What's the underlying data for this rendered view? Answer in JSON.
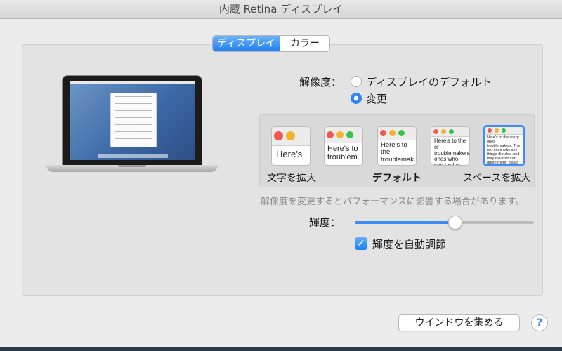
{
  "window": {
    "title": "内蔵 Retina ディスプレイ"
  },
  "tabs": [
    {
      "label": "ディスプレイ",
      "active": true
    },
    {
      "label": "カラー",
      "active": false
    }
  ],
  "resolution": {
    "label": "解像度：",
    "options": [
      {
        "label": "ディスプレイのデフォルト",
        "selected": false
      },
      {
        "label": "変更",
        "selected": true
      }
    ],
    "thumbnails": [
      {
        "text": "Here's",
        "selected": false
      },
      {
        "text": "Here's to troublem",
        "selected": false
      },
      {
        "text": "Here's to the troublemak ones who c",
        "selected": false
      },
      {
        "text": "Here's to the cr troublemakers. ones who see t rules. And they",
        "selected": false
      },
      {
        "text": "Here's to the crazy ones troublemakers. The rou ones who see things di rules. And they have no can quote them, disagr them. About the only th Because they change t",
        "selected": true
      }
    ],
    "scale_labels": {
      "larger_text": "文字を拡大",
      "default": "デフォルト",
      "more_space": "スペースを拡大"
    },
    "note": "解像度を変更するとパフォーマンスに影響する場合があります。"
  },
  "brightness": {
    "label": "輝度：",
    "value": 0.56,
    "auto_label": "輝度を自動調節",
    "auto_checked": true
  },
  "buttons": {
    "gather_windows": "ウインドウを集める",
    "help": "?"
  },
  "colors": {
    "accent": "#2b86f2",
    "traffic_red": "#ee5a52",
    "traffic_yellow": "#f3b32d",
    "traffic_green": "#3cc244"
  }
}
